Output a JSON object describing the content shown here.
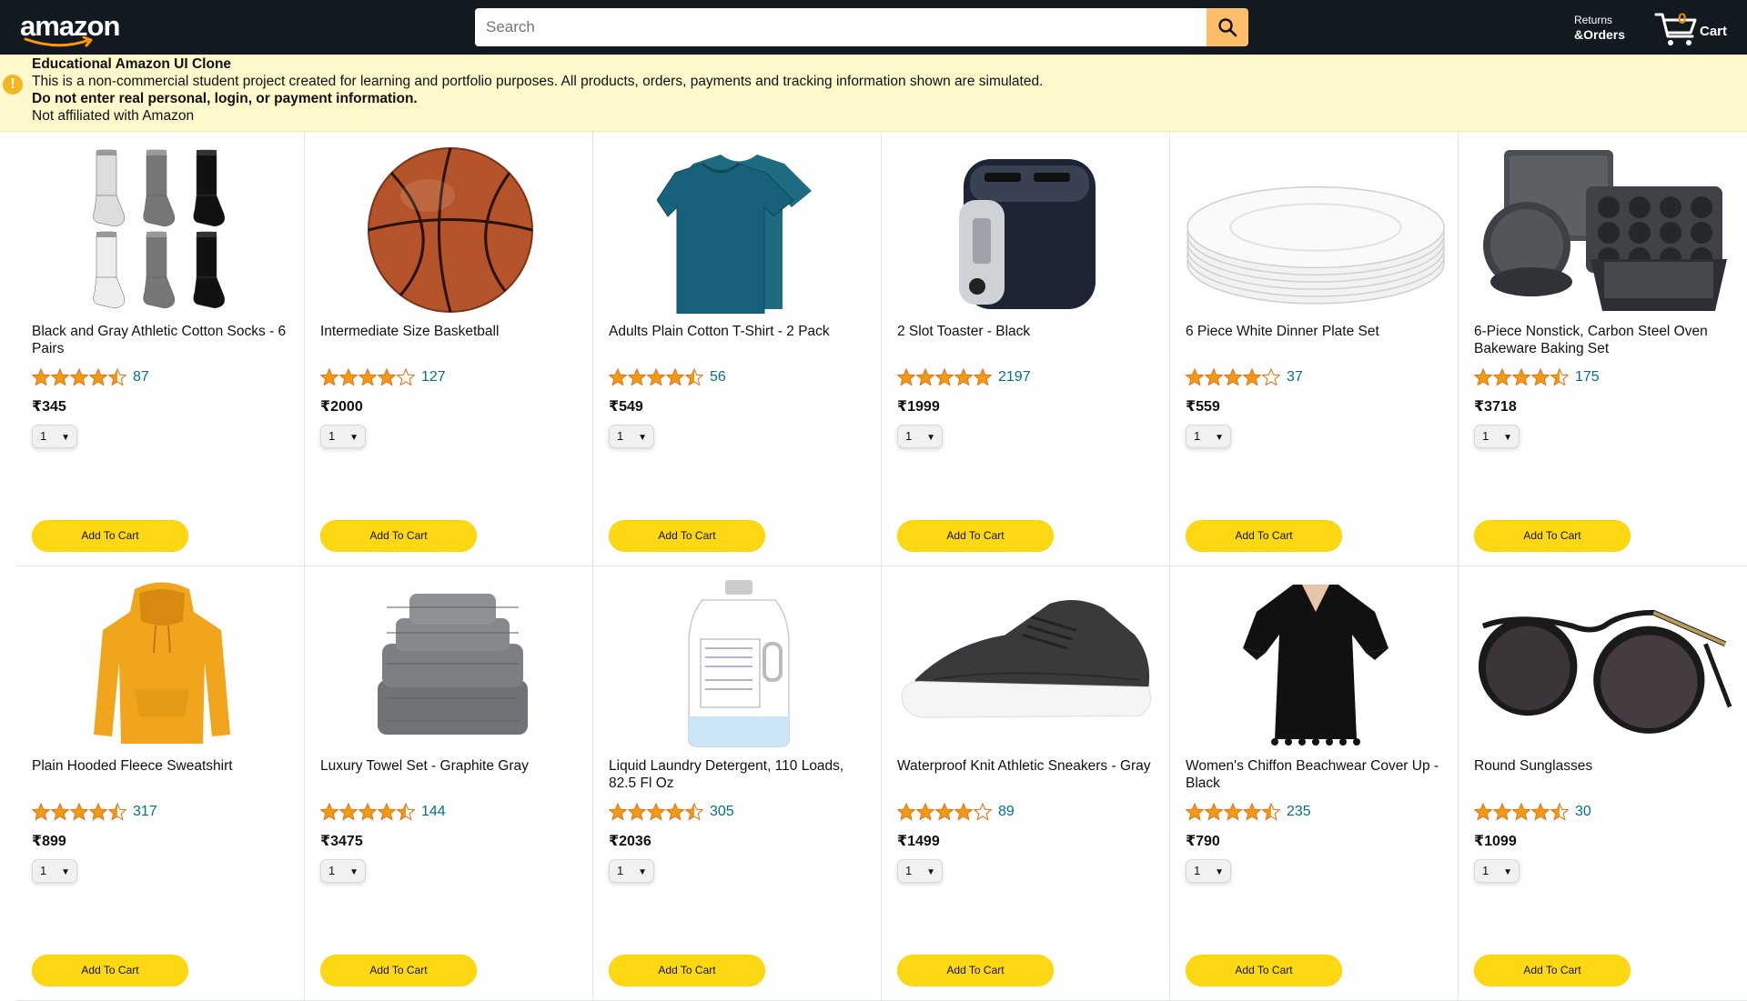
{
  "header": {
    "logo_text": "amazon",
    "search_placeholder": "Search",
    "orders_line1": "Returns",
    "orders_line2": "&Orders",
    "cart_count": "0",
    "cart_label": "Cart"
  },
  "notice": {
    "title": "Educational Amazon UI Clone",
    "line1": "This is a non-commercial student project created for learning and portfolio purposes. All products, orders, payments and tracking information shown are simulated.",
    "line2": "Do not enter real personal, login, or payment information.",
    "line3": "Not affiliated with Amazon"
  },
  "add_to_cart_label": "Add To Cart",
  "qty_default": "1",
  "products": [
    {
      "name": "Black and Gray Athletic Cotton Socks - 6 Pairs",
      "rating": 4.5,
      "count": "87",
      "price": "₹345",
      "image": "socks"
    },
    {
      "name": "Intermediate Size Basketball",
      "rating": 4.0,
      "count": "127",
      "price": "₹2000",
      "image": "basketball"
    },
    {
      "name": "Adults Plain Cotton T-Shirt - 2 Pack",
      "rating": 4.5,
      "count": "56",
      "price": "₹549",
      "image": "tshirt"
    },
    {
      "name": "2 Slot Toaster - Black",
      "rating": 5.0,
      "count": "2197",
      "price": "₹1999",
      "image": "toaster"
    },
    {
      "name": "6 Piece White Dinner Plate Set",
      "rating": 4.0,
      "count": "37",
      "price": "₹559",
      "image": "plates"
    },
    {
      "name": "6-Piece Nonstick, Carbon Steel Oven Bakeware Baking Set",
      "rating": 4.5,
      "count": "175",
      "price": "₹3718",
      "image": "bakeware"
    },
    {
      "name": "Plain Hooded Fleece Sweatshirt",
      "rating": 4.5,
      "count": "317",
      "price": "₹899",
      "image": "hoodie"
    },
    {
      "name": "Luxury Towel Set - Graphite Gray",
      "rating": 4.5,
      "count": "144",
      "price": "₹3475",
      "image": "towels"
    },
    {
      "name": "Liquid Laundry Detergent, 110 Loads, 82.5 Fl Oz",
      "rating": 4.5,
      "count": "305",
      "price": "₹2036",
      "image": "detergent"
    },
    {
      "name": "Waterproof Knit Athletic Sneakers - Gray",
      "rating": 4.0,
      "count": "89",
      "price": "₹1499",
      "image": "sneakers"
    },
    {
      "name": "Women's Chiffon Beachwear Cover Up - Black",
      "rating": 4.5,
      "count": "235",
      "price": "₹790",
      "image": "coverup"
    },
    {
      "name": "Round Sunglasses",
      "rating": 4.5,
      "count": "30",
      "price": "₹1099",
      "image": "sunglasses"
    }
  ]
}
